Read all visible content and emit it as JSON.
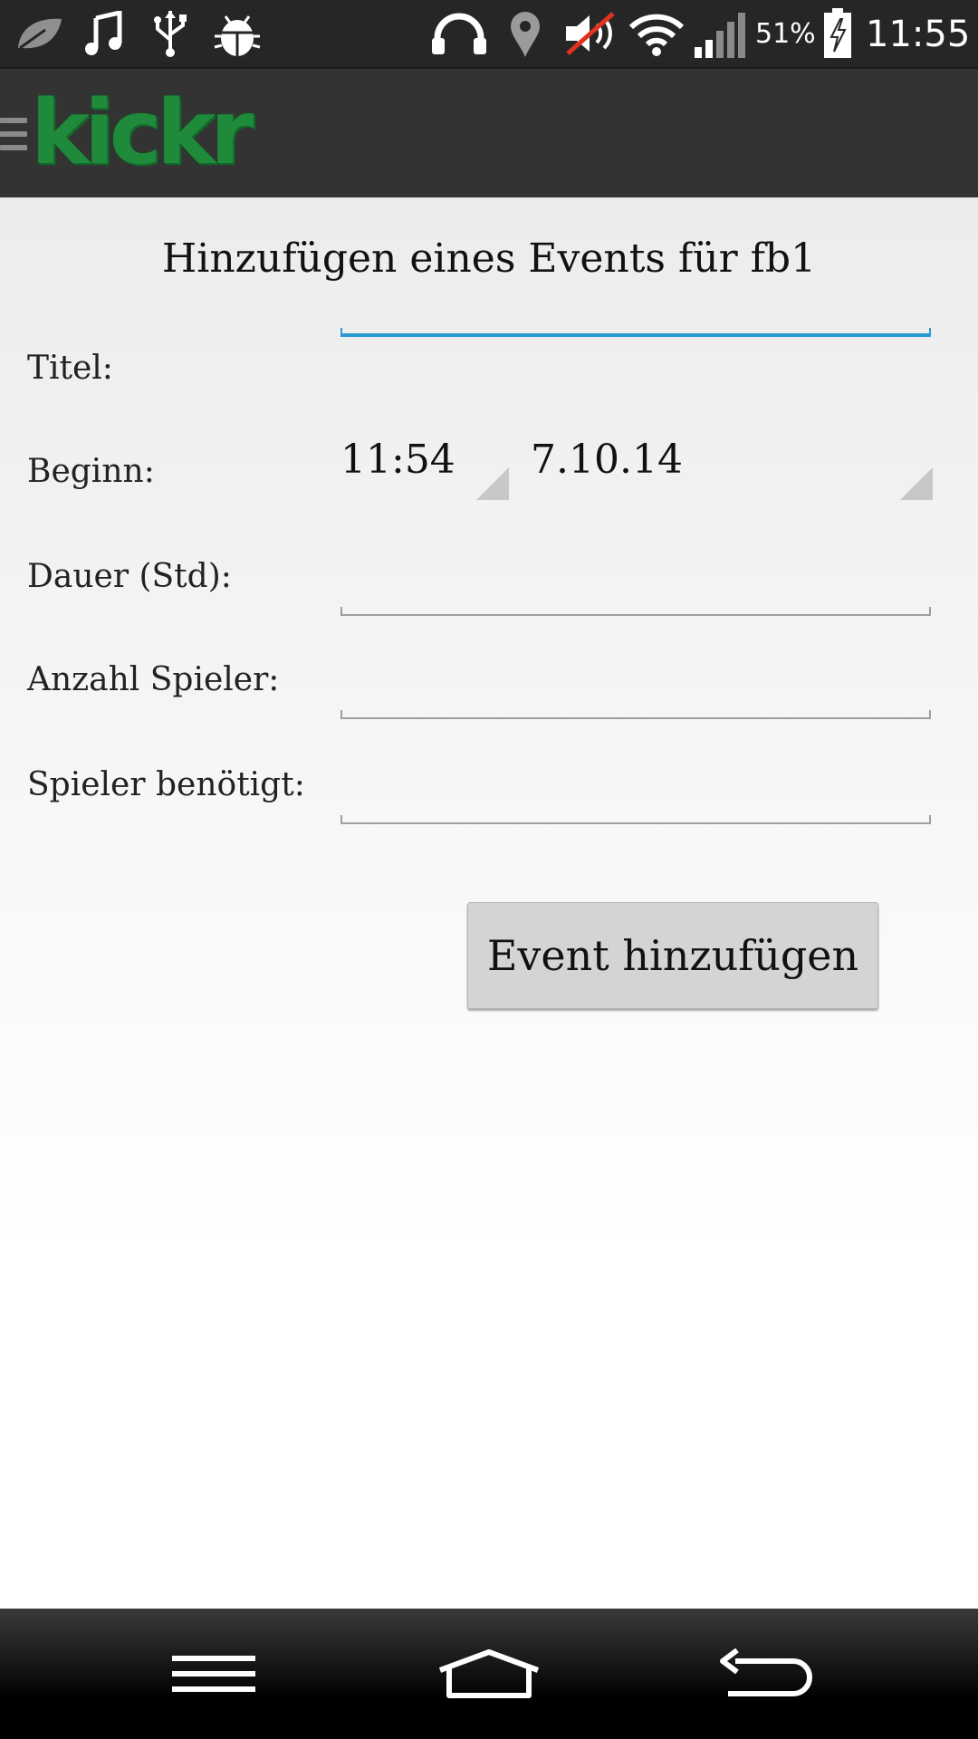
{
  "status_bar": {
    "icons": [
      "leaf-icon",
      "music-icon",
      "usb-icon",
      "android-debug-icon",
      "headphones-icon",
      "location-icon",
      "mute-icon",
      "wifi-icon",
      "signal-icon",
      "battery-charging-icon"
    ],
    "battery": "51%",
    "time": "11:55"
  },
  "action_bar": {
    "logo_text": "kickr"
  },
  "form": {
    "title": "Hinzufügen eines Events für fb1",
    "labels": {
      "title": "Titel:",
      "start": "Beginn:",
      "duration": "Dauer (Std):",
      "players": "Anzahl Spieler:",
      "needed": "Spieler benötigt:"
    },
    "values": {
      "title": "",
      "time": "11:54",
      "date": "7.10.14",
      "duration": "",
      "players": "",
      "needed": ""
    },
    "submit_label": "Event hinzufügen"
  },
  "nav_bar": {
    "buttons": [
      "menu-icon",
      "home-icon",
      "back-icon"
    ]
  }
}
